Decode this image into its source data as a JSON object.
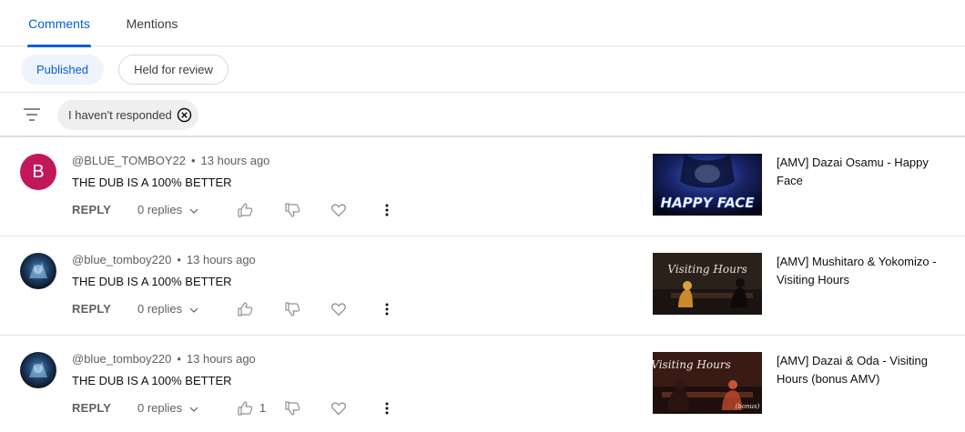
{
  "tabs": [
    {
      "label": "Comments",
      "active": true
    },
    {
      "label": "Mentions",
      "active": false
    }
  ],
  "chips": [
    {
      "label": "Published",
      "selected": true
    },
    {
      "label": "Held for review",
      "selected": false
    }
  ],
  "filter": {
    "icon": "filter-icon",
    "chip_label": "I haven't responded"
  },
  "comments": [
    {
      "avatar_letter": "B",
      "avatar_color": "#c2185b",
      "author": "@BLUE_TOMBOY22",
      "time": "13 hours ago",
      "text": "THE DUB IS A 100% BETTER",
      "reply_label": "REPLY",
      "replies_label": "0 replies",
      "likes": "",
      "video_title": "[AMV] Dazai Osamu - Happy Face",
      "thumb_text": "HAPPY FACE"
    },
    {
      "avatar_letter": "",
      "author": "@blue_tomboy220",
      "time": "13 hours ago",
      "text": "THE DUB IS A 100% BETTER",
      "reply_label": "REPLY",
      "replies_label": "0 replies",
      "likes": "",
      "video_title": "[AMV] Mushitaro & Yokomizo - Visiting Hours",
      "thumb_text": "Visiting Hours"
    },
    {
      "avatar_letter": "",
      "author": "@blue_tomboy220",
      "time": "13 hours ago",
      "text": "THE DUB IS A 100% BETTER",
      "reply_label": "REPLY",
      "replies_label": "0 replies",
      "likes": "1",
      "video_title": "[AMV] Dazai & Oda - Visiting Hours (bonus AMV)",
      "thumb_text": "Visiting Hours",
      "thumb_subtext": "(bonus)"
    }
  ],
  "colors": {
    "accent": "#065fd4",
    "chip_selected_bg": "#eef3fd"
  }
}
